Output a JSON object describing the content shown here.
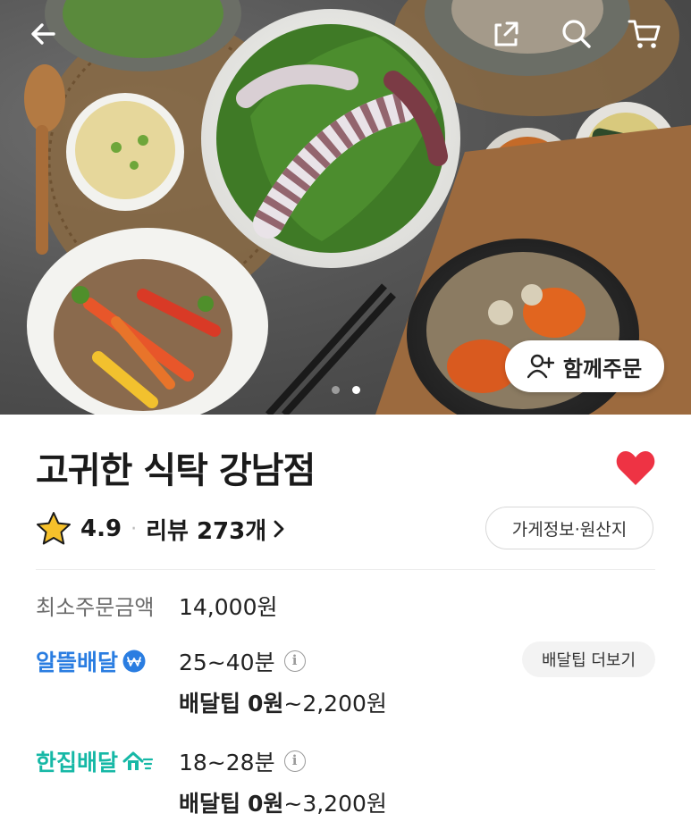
{
  "hero": {
    "group_order_label": "함께주문",
    "carousel_total": 2,
    "carousel_active": 2
  },
  "store": {
    "name": "고귀한 식탁 강남점",
    "favorited": true,
    "rating": "4.9",
    "rating_separator": "·",
    "reviews_label": "리뷰 273개",
    "info_button": "가게정보·원산지"
  },
  "min_order": {
    "label": "최소주문금액",
    "value": "14,000원"
  },
  "delivery": [
    {
      "brand": "알뜰배달",
      "brand_color": "#2a7de1",
      "time": "25~40분",
      "tip_label": "배달팁",
      "tip_min": "0원",
      "tip_rest": "~2,200원",
      "more_button": "배달팁 더보기"
    },
    {
      "brand": "한집배달",
      "brand_color": "#16b8a6",
      "time": "18~28분",
      "tip_label": "배달팁",
      "tip_min": "0원",
      "tip_rest": "~3,200원"
    }
  ],
  "icons": {
    "back": "back-arrow-icon",
    "share": "share-icon",
    "search": "search-icon",
    "cart": "cart-icon",
    "heart": "heart-icon",
    "star": "star-icon",
    "chevron": "chevron-right-icon",
    "add_person": "add-person-icon",
    "info": "info-icon"
  },
  "colors": {
    "heart": "#ee3344",
    "star": "#f6c12b"
  }
}
